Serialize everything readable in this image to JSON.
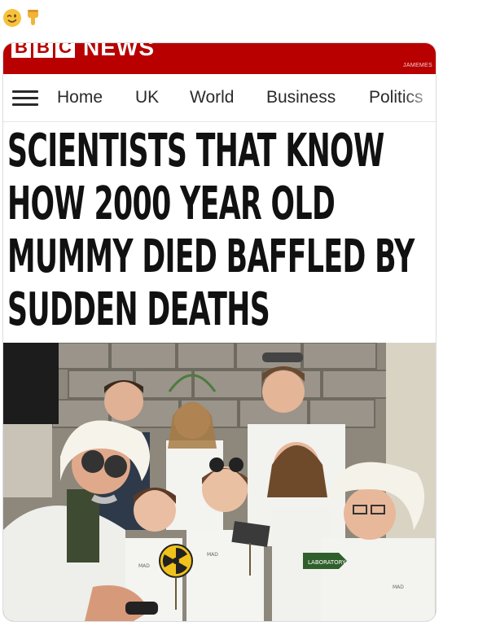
{
  "tweet": {
    "emojis": [
      {
        "icon": "winking-face-emoji"
      },
      {
        "icon": "pointing-down-hand-emoji"
      }
    ]
  },
  "bbc": {
    "logo_letters": [
      "B",
      "B",
      "C"
    ],
    "news_word": "NEWS",
    "watermark": "JAMEMES",
    "brand_color": "#b80000"
  },
  "nav": {
    "items": [
      "Home",
      "UK",
      "World",
      "Business",
      "Politics"
    ]
  },
  "headline": {
    "lines": [
      "SCIENTISTS THAT KNOW",
      "HOW 2000 YEAR OLD",
      "MUMMY DIED BAFFLED BY",
      "SUDDEN DEATHS"
    ]
  },
  "photo": {
    "props": {
      "sign_left": "MAD",
      "sign_center": "MAD",
      "arrow_sign": "LABORATORY",
      "badge_right": "MAD"
    }
  }
}
